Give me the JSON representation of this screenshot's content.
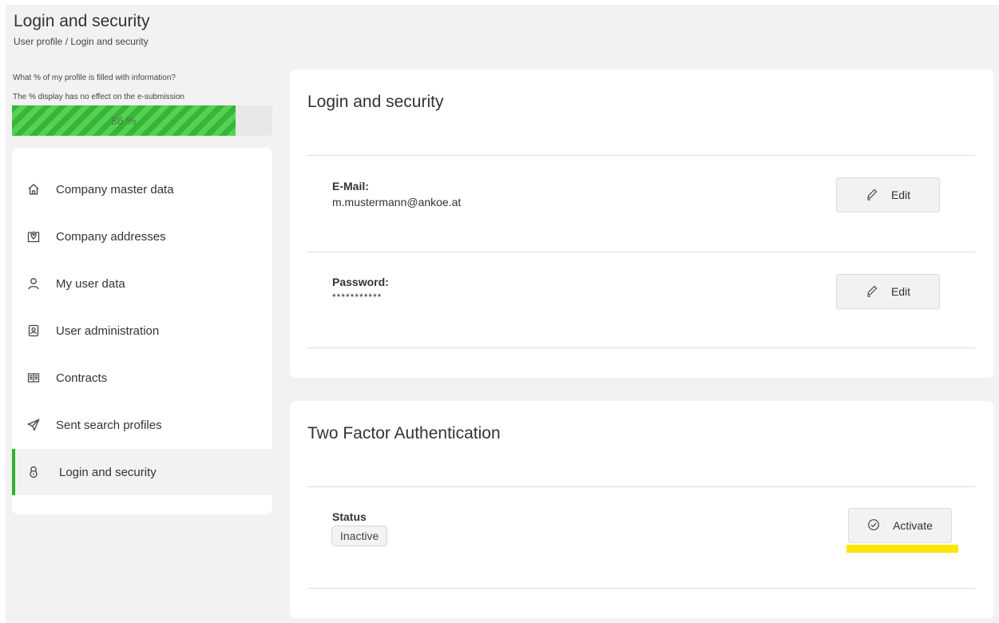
{
  "header": {
    "title": "Login and security",
    "breadcrumb": "User profile / Login and security"
  },
  "profile_fill": {
    "question": "What % of my profile is filled with information?",
    "note": "The % display has no effect on the e-submission",
    "percent": 86,
    "label": "86 %",
    "color": "#3cc23c"
  },
  "sidebar": {
    "items": [
      {
        "label": "Company master data",
        "icon": "home-icon"
      },
      {
        "label": "Company addresses",
        "icon": "map-pin-icon"
      },
      {
        "label": "My user data",
        "icon": "user-icon"
      },
      {
        "label": "User administration",
        "icon": "user-badge-icon"
      },
      {
        "label": "Contracts",
        "icon": "book-icon"
      },
      {
        "label": "Sent search profiles",
        "icon": "paper-plane-icon"
      },
      {
        "label": "Login and security",
        "icon": "lock-icon",
        "active": true
      }
    ],
    "active_color": "#2cb52c"
  },
  "login_card": {
    "title": "Login and security",
    "email": {
      "label": "E-Mail:",
      "value": "m.mustermann@ankoe.at",
      "button": "Edit"
    },
    "password": {
      "label": "Password:",
      "value": "***********",
      "button": "Edit"
    }
  },
  "tfa_card": {
    "title": "Two Factor Authentication",
    "status_label": "Status",
    "status_value": "Inactive",
    "button": "Activate",
    "highlight_color": "#ffe600"
  }
}
